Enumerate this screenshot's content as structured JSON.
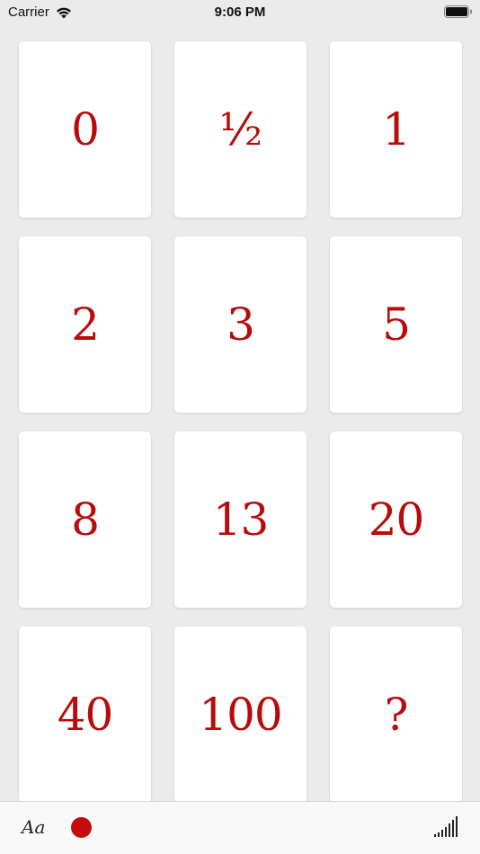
{
  "status_bar": {
    "carrier": "Carrier",
    "time": "9:06 PM"
  },
  "cards": [
    {
      "value": "0"
    },
    {
      "value": "½"
    },
    {
      "value": "1"
    },
    {
      "value": "2"
    },
    {
      "value": "3"
    },
    {
      "value": "5"
    },
    {
      "value": "8"
    },
    {
      "value": "13"
    },
    {
      "value": "20"
    },
    {
      "value": "40"
    },
    {
      "value": "100"
    },
    {
      "value": "?"
    }
  ],
  "toolbar": {
    "font_label": "Aa",
    "color_hex": "#c40a0a",
    "icons": [
      "font-style-icon",
      "color-dot-icon",
      "signal-bars-icon"
    ]
  },
  "colors": {
    "card_text": "#b80b0b",
    "background": "#ebebeb",
    "card": "#ffffff"
  }
}
